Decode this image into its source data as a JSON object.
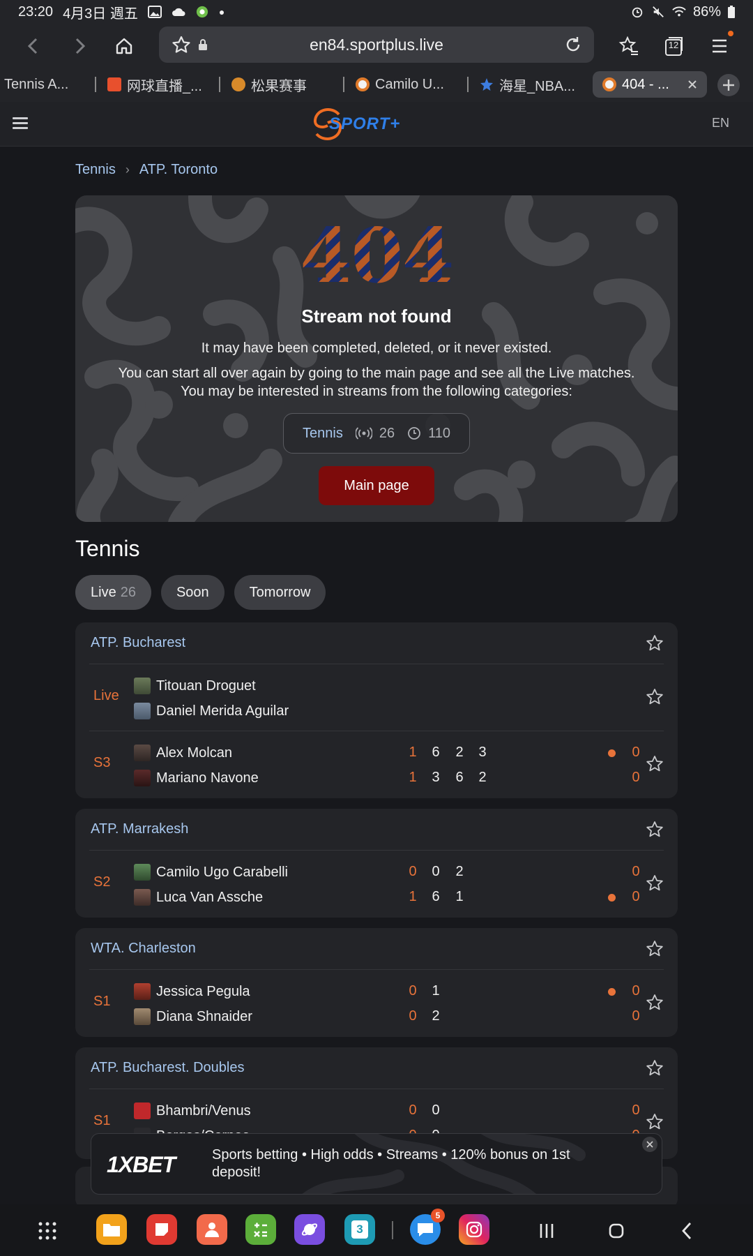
{
  "status_bar": {
    "time": "23:20",
    "date": "4月3日 週五",
    "battery": "86%"
  },
  "browser": {
    "url": "en84.sportplus.live",
    "tab_count": "12"
  },
  "tabs": [
    {
      "label": "Tennis A..."
    },
    {
      "label": "网球直播_..."
    },
    {
      "label": "松果赛事"
    },
    {
      "label": "Camilo U..."
    },
    {
      "label": "海星_NBA..."
    },
    {
      "label": "404 - ..."
    }
  ],
  "header": {
    "logo_text": "SPORT+",
    "lang": "EN"
  },
  "breadcrumb": {
    "item1": "Tennis",
    "item2": "ATP. Toronto"
  },
  "not_found": {
    "code": "404",
    "title": "Stream not found",
    "line1": "It may have been completed, deleted, or it never existed.",
    "line2": "You can start all over again by going to the main page and see all the Live matches.",
    "line3": "You may be interested in streams from the following categories:",
    "category": {
      "name": "Tennis",
      "live": "26",
      "upcoming": "110"
    },
    "main_button": "Main page"
  },
  "section": {
    "title": "Tennis",
    "filters": {
      "live": "Live",
      "live_count": "26",
      "soon": "Soon",
      "tomorrow": "Tomorrow"
    }
  },
  "leagues": [
    {
      "name": "ATP. Bucharest",
      "matches": [
        {
          "status": "Live",
          "p1": "Titouan Droguet",
          "p2": "Daniel Merida Aguilar"
        },
        {
          "status": "S3",
          "p1": "Alex Molcan",
          "p2": "Mariano Navone",
          "s1": [
            "1",
            "6",
            "2",
            "3"
          ],
          "s2": [
            "1",
            "3",
            "6",
            "2"
          ],
          "pt1": "0",
          "pt2": "0"
        }
      ]
    },
    {
      "name": "ATP. Marrakesh",
      "matches": [
        {
          "status": "S2",
          "p1": "Camilo Ugo Carabelli",
          "p2": "Luca Van Assche",
          "s1": [
            "0",
            "0",
            "2"
          ],
          "s2": [
            "1",
            "6",
            "1"
          ],
          "pt1": "0",
          "pt2": "0"
        }
      ]
    },
    {
      "name": "WTA. Charleston",
      "matches": [
        {
          "status": "S1",
          "p1": "Jessica Pegula",
          "p2": "Diana Shnaider",
          "s1": [
            "0",
            "1"
          ],
          "s2": [
            "0",
            "2"
          ],
          "pt1": "0",
          "pt2": "0"
        }
      ]
    },
    {
      "name": "ATP. Bucharest. Doubles",
      "matches": [
        {
          "status": "S1",
          "p1": "Bhambri/Venus",
          "p2": "Borges/Cornea",
          "s1": [
            "0",
            "0"
          ],
          "s2": [
            "0",
            "0"
          ],
          "pt1": "0",
          "pt2": "0"
        }
      ]
    }
  ],
  "ad": {
    "brand": "1XBET",
    "text": "Sports betting • High odds • Streams • 120% bonus on 1st deposit!"
  },
  "nav": {
    "calendar_day": "3",
    "notification_badge": "5"
  },
  "colors": {
    "accent_orange": "#e8733a",
    "link_blue": "#a7c7ee",
    "main_button": "#7d0b0b",
    "background": "#17181c"
  }
}
